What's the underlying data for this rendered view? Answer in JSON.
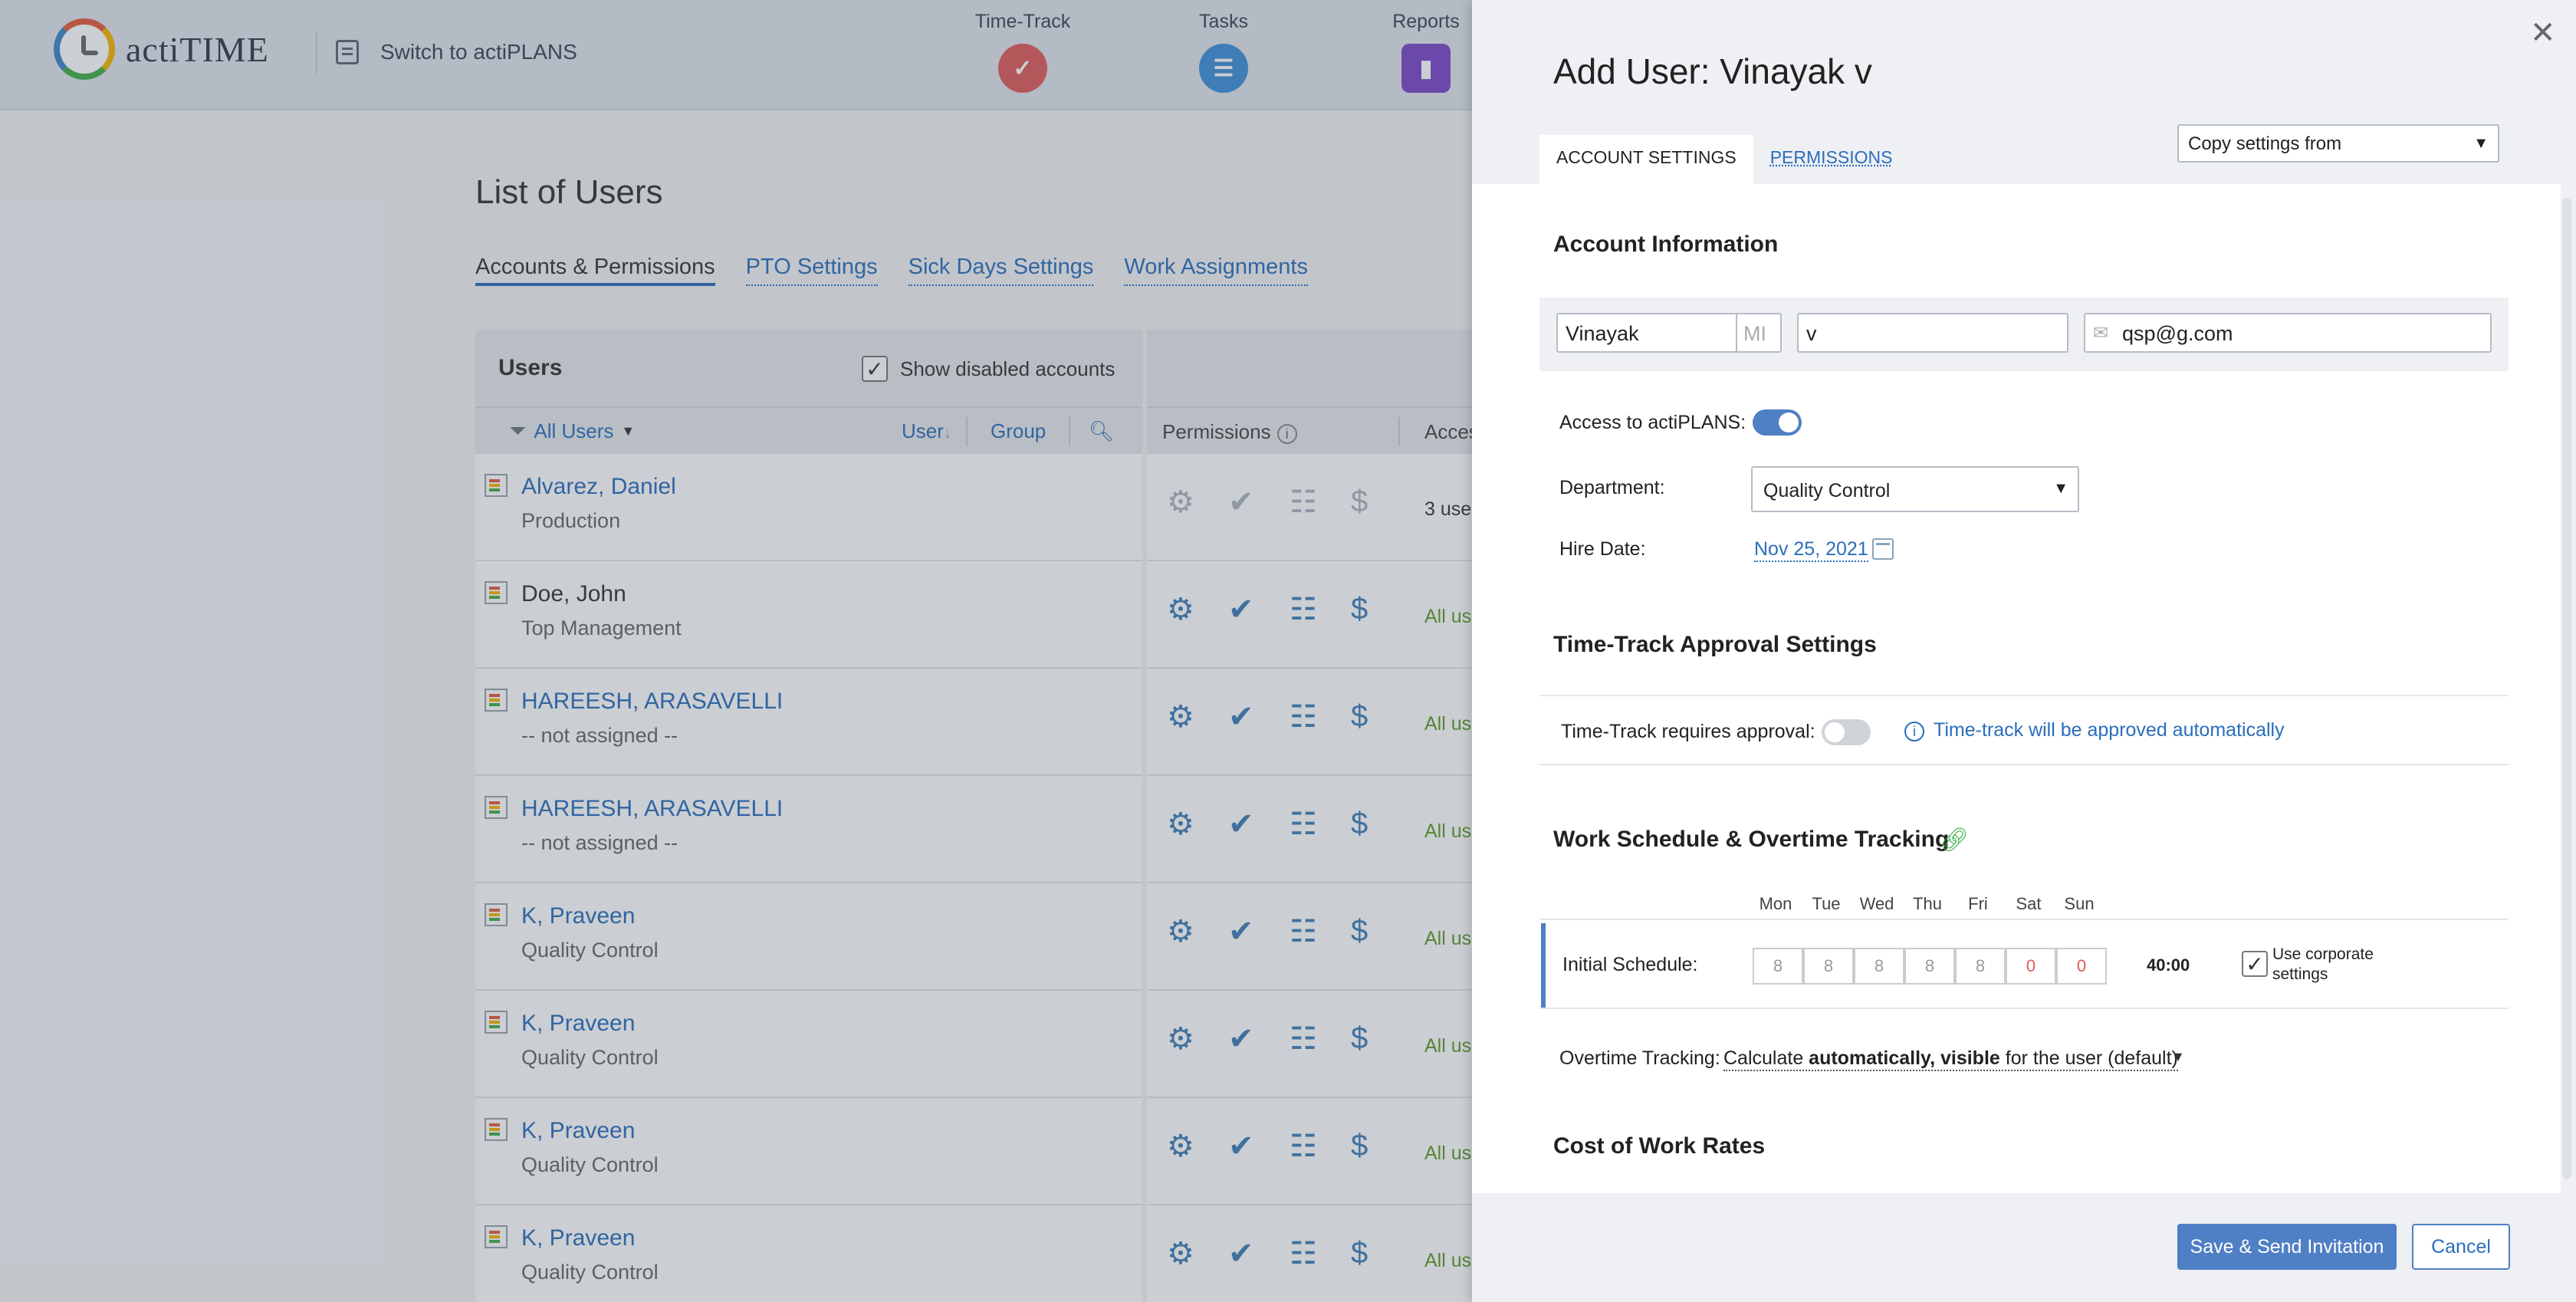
{
  "app": {
    "logo_text": "actiTIME",
    "switch_label": "Switch to actiPLANS"
  },
  "nav": [
    {
      "label": "Time-Track",
      "icon": "checkmark-icon",
      "color": "#e05a5a"
    },
    {
      "label": "Tasks",
      "icon": "list-icon",
      "color": "#3d8fd8"
    },
    {
      "label": "Reports",
      "icon": "bar-chart-icon",
      "color": "#7b47c9"
    }
  ],
  "page": {
    "title": "List of Users",
    "tabs": [
      "Accounts & Permissions",
      "PTO Settings",
      "Sick Days Settings",
      "Work Assignments"
    ]
  },
  "users_table": {
    "title": "Users",
    "show_disabled_label": "Show disabled accounts",
    "filter_label": "All Users",
    "col_user": "User",
    "col_group": "Group",
    "col_permissions": "Permissions",
    "col_access": "Acces",
    "rows": [
      {
        "name": "Alvarez, Daniel",
        "dept": "Production",
        "access": "3 use"
      },
      {
        "name": "Doe, John",
        "dept": "Top Management",
        "access": "All us"
      },
      {
        "name": "HAREESH, ARASAVELLI",
        "dept": "-- not assigned --",
        "access": "All us"
      },
      {
        "name": "HAREESH, ARASAVELLI",
        "dept": "-- not assigned --",
        "access": "All us"
      },
      {
        "name": "K, Praveen",
        "dept": "Quality Control",
        "access": "All us"
      },
      {
        "name": "K, Praveen",
        "dept": "Quality Control",
        "access": "All us"
      },
      {
        "name": "K, Praveen",
        "dept": "Quality Control",
        "access": "All us"
      },
      {
        "name": "K, Praveen",
        "dept": "Quality Control",
        "access": "All us"
      }
    ]
  },
  "panel": {
    "title": "Add User: Vinayak v",
    "tabs": [
      "ACCOUNT SETTINGS",
      "PERMISSIONS"
    ],
    "copy_settings": "Copy settings from",
    "account_info": {
      "title": "Account Information",
      "first_name": "Vinayak",
      "mi_placeholder": "MI",
      "last_name": "v",
      "email": "qsp@g.com",
      "access_label": "Access to actiPLANS:",
      "access_on": true,
      "department_label": "Department:",
      "department": "Quality Control",
      "hire_label": "Hire Date:",
      "hire_date": "Nov 25, 2021"
    },
    "approval": {
      "title": "Time-Track Approval Settings",
      "label": "Time-Track requires approval:",
      "enabled": false,
      "info": "Time-track will be approved automatically"
    },
    "schedule": {
      "title": "Work Schedule & Overtime Tracking",
      "days": [
        "Mon",
        "Tue",
        "Wed",
        "Thu",
        "Fri",
        "Sat",
        "Sun"
      ],
      "initial_label": "Initial Schedule:",
      "hours": [
        "8",
        "8",
        "8",
        "8",
        "8",
        "0",
        "0"
      ],
      "total": "40:00",
      "corporate_label": "Use corporate settings",
      "overtime_label": "Overtime Tracking:",
      "overtime_prefix": "Calculate ",
      "overtime_bold": "automatically, visible",
      "overtime_suffix": " for the user (default)"
    },
    "cost": {
      "title": "Cost of Work Rates"
    },
    "save_label": "Save & Send Invitation",
    "cancel_label": "Cancel"
  }
}
